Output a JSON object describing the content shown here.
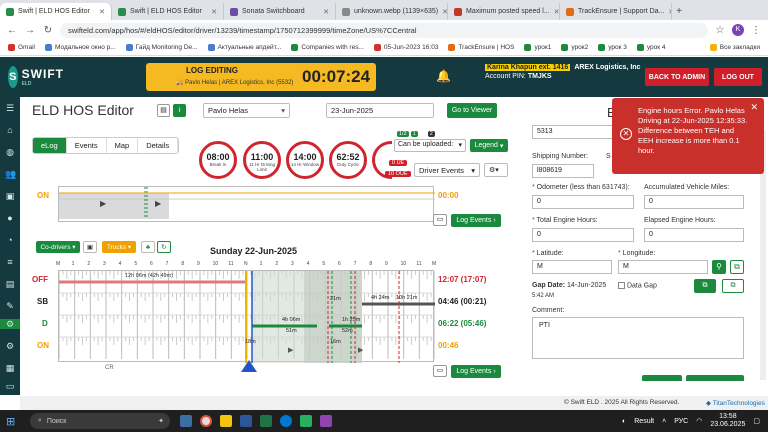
{
  "browser": {
    "tabs": [
      {
        "label": "Swift | ELD HOS Editor",
        "active": true
      },
      {
        "label": "Swift | ELD HOS Editor"
      },
      {
        "label": "Sonata Switchboard"
      },
      {
        "label": "unknown.webp (1139×635)"
      },
      {
        "label": "Maximum posted speed l..."
      },
      {
        "label": "TrackEnsure | Support Da..."
      }
    ],
    "url": "swifteld.com/app/hos/#/eldHOS/editor/driver/13239/timestamp/1750712399999/timeZone/US%7CCentral",
    "bookmarks": [
      "Gmail",
      "Модальное окно р...",
      "Гайд Monitoring De...",
      "Актуальные апдейт...",
      "Companies with res...",
      "05-Jun-2023 16:03",
      "TrackEnsure | HOS",
      "урок1",
      "урок2",
      "урок 3",
      "урок 4",
      "Все закладки"
    ]
  },
  "header": {
    "brand": "SWIFT",
    "brand_sub": "ELD",
    "log_editing": "LOG EDITING",
    "editor_user": "Pavlo Helas",
    "editor_meta": "AREX Logistics, Inc (5532)",
    "timer": "00:07:24",
    "user_name": "Karina Khapun ext. 1416",
    "company": "AREX Logistics, Inc",
    "account_pin_label": "Account PIN:",
    "account_pin": "TMJKS",
    "back_to_admin": "BACK TO ADMIN",
    "log_out": "LOG OUT"
  },
  "page": {
    "title": "ELD HOS Editor",
    "driver": "Pavlo Helas",
    "date": "23-Jun-2025",
    "go_to_viewer": "Go to Viewer",
    "tabs": [
      "eLog",
      "Events",
      "Map",
      "Details"
    ],
    "gauges": [
      {
        "value": "08:00",
        "label": "Break In"
      },
      {
        "value": "11:00",
        "label": "11 Hr Driving Limit"
      },
      {
        "value": "14:00",
        "label": "14 Hr Window"
      },
      {
        "value": "62:52",
        "label": "Duty Cycle"
      }
    ],
    "can_be_uploaded": "Can be uploaded:",
    "legend": "Legend",
    "driver_events": "Driver Events",
    "badge_green_1": "1/2",
    "badge_green_2": "1",
    "badge_dark": "2",
    "badge_red_1": "0 UE",
    "badge_red_2": "10 OUE"
  },
  "top_graph": {
    "on_label": "ON",
    "on_total": "00:00",
    "log_events": "Log Events"
  },
  "graph": {
    "co_drivers": "Co-drivers",
    "trucks": "Trucks",
    "day": "Sunday 22-Jun-2025",
    "hours": [
      "M",
      "1",
      "2",
      "3",
      "4",
      "5",
      "6",
      "7",
      "8",
      "9",
      "10",
      "11",
      "N",
      "1",
      "2",
      "3",
      "4",
      "5",
      "6",
      "7",
      "8",
      "9",
      "10",
      "11",
      "M"
    ],
    "statuses": [
      {
        "code": "OFF",
        "total": "12:07 (17:07)",
        "color": "#d0242e"
      },
      {
        "code": "SB",
        "total": "04:46 (00:21)",
        "color": "#222"
      },
      {
        "code": "D",
        "total": "06:22 (05:46)",
        "color": "#1b8a3e"
      },
      {
        "code": "ON",
        "total": "00:46",
        "color": "#f0a000"
      }
    ],
    "labels": {
      "off_bar": "12h 06m (42h 49m)",
      "d1": "4h 06m",
      "d1b": "51m",
      "d2": "1h 25m",
      "d2b": "52m",
      "sb1": "21m",
      "sb2": "4h 24m",
      "sb3": "10h 21m",
      "on1": "18m",
      "on2": "16m",
      "cr": "CR"
    },
    "log_events": "Log Events"
  },
  "form": {
    "field_5313": "5313",
    "shipping_label": "Shipping Number:",
    "shipping_value": "l808619",
    "odometer_label": "Odometer (less than 631743):",
    "odometer_value": "0",
    "acc_miles_label": "Accumulated Vehicle Miles:",
    "acc_miles_value": "0",
    "total_hours_label": "Total Engine Hours:",
    "total_hours_value": "0",
    "elapsed_label": "Elapsed Engine Hours:",
    "elapsed_value": "0",
    "lat_label": "Latitude:",
    "lat_value": "M",
    "lng_label": "Longitude:",
    "lng_value": "M",
    "gap_date_label": "Gap Date:",
    "gap_date_value": "14-Jun-2025",
    "gap_time": "5:42 AM",
    "data_gap": "Data Gap",
    "comment_label": "Comment:",
    "comment_value": "PTI"
  },
  "toast": {
    "message": "Engine hours Error. Pavlo Helas Driving at 22-Jun-2025 12:35:33. Difference between TEH and EEH increase is more than 0.1 hour."
  },
  "footer": {
    "copyright": "© Swift ELD . 2025 All Rights Reserved.",
    "powered": "TitanTechnologies"
  },
  "taskbar": {
    "search": "Поиск",
    "weather": "Result",
    "lang": "РУС",
    "time": "13:58",
    "date": "23.06.2025"
  },
  "colors": {
    "header_bg": "#14393f",
    "accent_green": "#1b8a3e",
    "danger_red": "#d01f2b",
    "warning_yellow": "#f5b921"
  }
}
